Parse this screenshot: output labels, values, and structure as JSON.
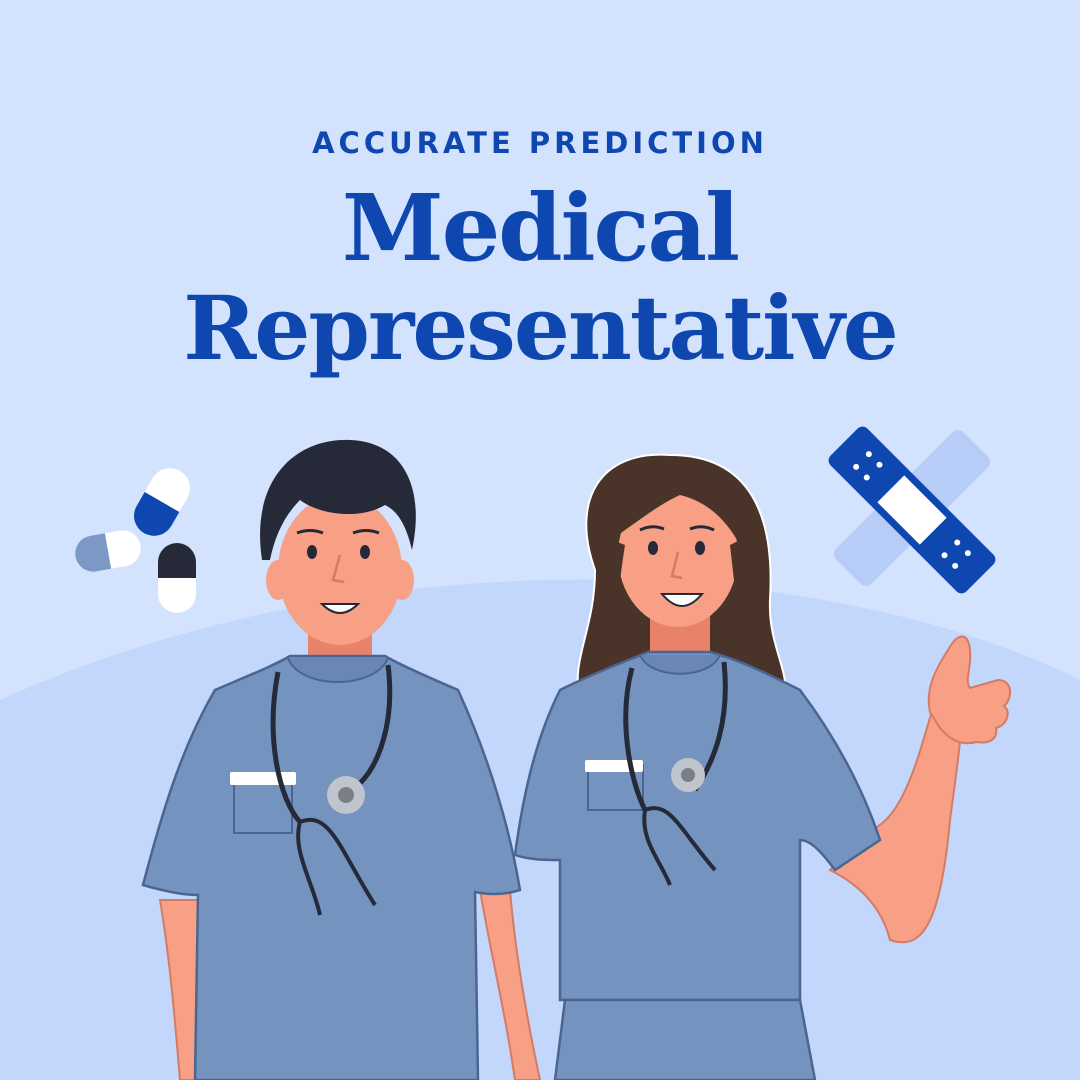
{
  "header": {
    "eyebrow": "ACCURATE PREDICTION",
    "title_line1": "Medical",
    "title_line2": "Representative"
  },
  "colors": {
    "background": "#d3e3fd",
    "hill": "#c2d7fb",
    "accent_blue": "#0e47b0",
    "scrubs": "#7593bf",
    "scrubs_outline": "#4a6690",
    "skin": "#f7a086",
    "hair_dark": "#262a38",
    "hair_brown": "#4a3328"
  },
  "icons": {
    "pills": "capsule-pills-icon",
    "bandage": "adhesive-bandage-icon",
    "stethoscope": "stethoscope-icon"
  }
}
